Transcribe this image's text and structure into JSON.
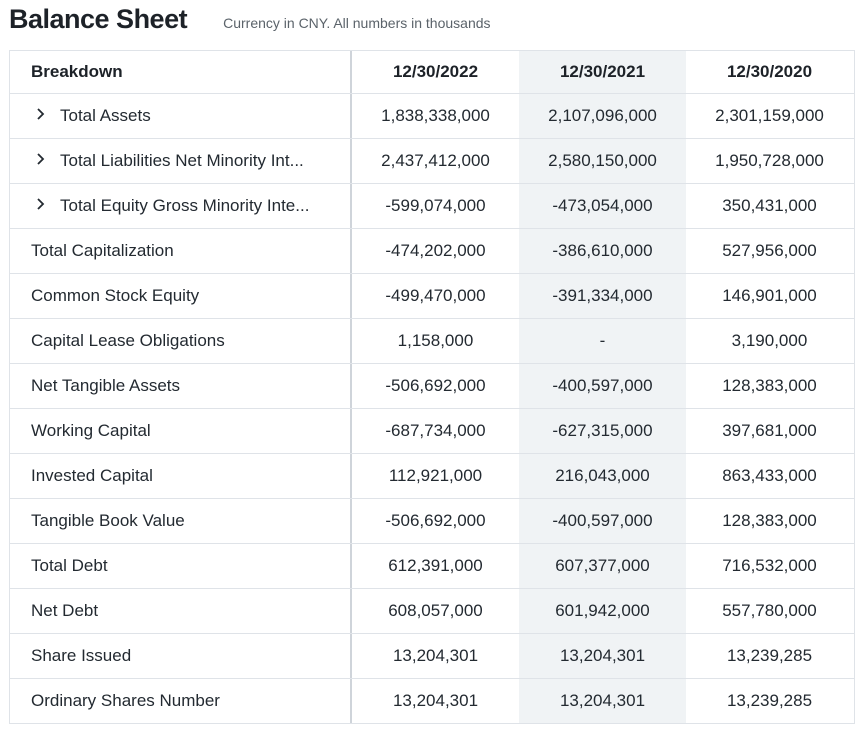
{
  "header": {
    "title": "Balance Sheet",
    "subtitle": "Currency in CNY. All numbers in thousands"
  },
  "table": {
    "breakdown_label": "Breakdown",
    "columns": [
      "12/30/2022",
      "12/30/2021",
      "12/30/2020"
    ],
    "rows": [
      {
        "label": "Total Assets",
        "expandable": true,
        "values": [
          "1,838,338,000",
          "2,107,096,000",
          "2,301,159,000"
        ]
      },
      {
        "label": "Total Liabilities Net Minority Int...",
        "expandable": true,
        "values": [
          "2,437,412,000",
          "2,580,150,000",
          "1,950,728,000"
        ]
      },
      {
        "label": "Total Equity Gross Minority Inte...",
        "expandable": true,
        "values": [
          "-599,074,000",
          "-473,054,000",
          "350,431,000"
        ]
      },
      {
        "label": "Total Capitalization",
        "expandable": false,
        "values": [
          "-474,202,000",
          "-386,610,000",
          "527,956,000"
        ]
      },
      {
        "label": "Common Stock Equity",
        "expandable": false,
        "values": [
          "-499,470,000",
          "-391,334,000",
          "146,901,000"
        ]
      },
      {
        "label": "Capital Lease Obligations",
        "expandable": false,
        "values": [
          "1,158,000",
          "-",
          "3,190,000"
        ]
      },
      {
        "label": "Net Tangible Assets",
        "expandable": false,
        "values": [
          "-506,692,000",
          "-400,597,000",
          "128,383,000"
        ]
      },
      {
        "label": "Working Capital",
        "expandable": false,
        "values": [
          "-687,734,000",
          "-627,315,000",
          "397,681,000"
        ]
      },
      {
        "label": "Invested Capital",
        "expandable": false,
        "values": [
          "112,921,000",
          "216,043,000",
          "863,433,000"
        ]
      },
      {
        "label": "Tangible Book Value",
        "expandable": false,
        "values": [
          "-506,692,000",
          "-400,597,000",
          "128,383,000"
        ]
      },
      {
        "label": "Total Debt",
        "expandable": false,
        "values": [
          "612,391,000",
          "607,377,000",
          "716,532,000"
        ]
      },
      {
        "label": "Net Debt",
        "expandable": false,
        "values": [
          "608,057,000",
          "601,942,000",
          "557,780,000"
        ]
      },
      {
        "label": "Share Issued",
        "expandable": false,
        "values": [
          "13,204,301",
          "13,204,301",
          "13,239,285"
        ]
      },
      {
        "label": "Ordinary Shares Number",
        "expandable": false,
        "values": [
          "13,204,301",
          "13,204,301",
          "13,239,285"
        ]
      }
    ],
    "chevron_icon": "chevron-right-icon",
    "colors": {
      "shaded_column": "#f0f3f5",
      "border": "#dfe3e8",
      "text": "#232a31"
    }
  }
}
